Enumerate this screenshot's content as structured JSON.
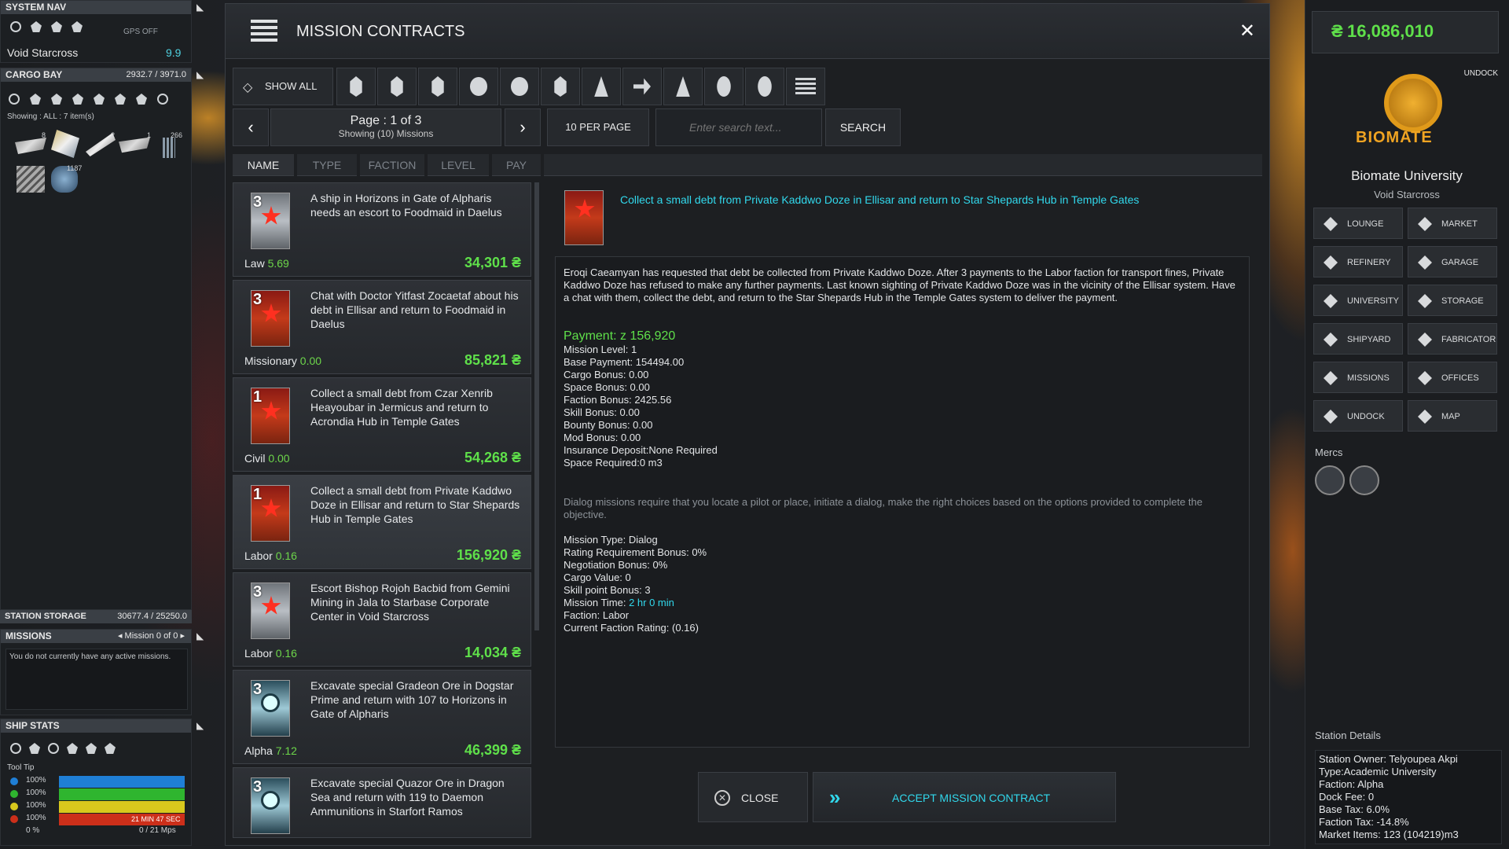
{
  "left": {
    "system_nav": {
      "header": "SYSTEM NAV",
      "gps": "GPS OFF",
      "system": "Void Starcross",
      "value": "9.9"
    },
    "cargo": {
      "header": "CARGO BAY",
      "capacity": "2932.7 / 3971.0",
      "showing": "Showing : ALL : 7 item(s)",
      "q1": "8",
      "q2": "2",
      "q3": "1",
      "q4": "266",
      "q5": "1187"
    },
    "station_storage": {
      "header": "STATION STORAGE",
      "capacity": "30677.4 / 25250.0"
    },
    "missions": {
      "header": "MISSIONS",
      "pager": "Mission 0 of 0",
      "empty": "You do not currently have any active missions."
    },
    "ship_stats": {
      "header": "SHIP STATS",
      "tooltip": "Tool Tip",
      "rows": [
        {
          "pct": "100%",
          "color": "#1f7fd6"
        },
        {
          "pct": "100%",
          "color": "#2fb52f"
        },
        {
          "pct": "100%",
          "color": "#d8c81d"
        },
        {
          "pct": "100%",
          "color": "#cc2f1a",
          "extra": "21 MIN 47 SEC"
        }
      ],
      "last_pct": "0 %",
      "last_extra": "0 / 21 Mps"
    }
  },
  "contracts": {
    "title": "MISSION CONTRACTS",
    "show_all": "SHOW ALL",
    "page": "Page : 1 of 3",
    "showing": "Showing (10) Missions",
    "per_page": "10  PER PAGE",
    "search_placeholder": "Enter search text...",
    "search_label": "SEARCH",
    "columns": [
      "NAME",
      "TYPE",
      "FACTION",
      "LEVEL",
      "PAY"
    ],
    "list": [
      {
        "level": "3",
        "desc": "A ship in Horizons in Gate of Alpharis needs an escort to Foodmaid in Daelus",
        "faction": "Law",
        "rating": "5.69",
        "pay": "34,301 ₴",
        "badge": "gray"
      },
      {
        "level": "3",
        "desc": "Chat with Doctor Yitfast Zocaetaf about his debt in Ellisar and return to Foodmaid in Daelus",
        "faction": "Missionary",
        "rating": "0.00",
        "pay": "85,821 ₴",
        "badge": "red"
      },
      {
        "level": "1",
        "desc": "Collect a small debt from Czar Xenrib Heayoubar in Jermicus and return to Acrondia Hub in Temple Gates",
        "faction": "Civil",
        "rating": "0.00",
        "pay": "54,268 ₴",
        "badge": "red"
      },
      {
        "level": "1",
        "desc": "Collect a small debt from Private Kaddwo Doze in Ellisar and return to Star Shepards Hub in Temple Gates",
        "faction": "Labor",
        "rating": "0.16",
        "pay": "156,920 ₴",
        "badge": "red"
      },
      {
        "level": "3",
        "desc": "Escort Bishop Rojoh Bacbid from Gemini Mining in Jala to Starbase Corporate Center in Void Starcross",
        "faction": "Labor",
        "rating": "0.16",
        "pay": "14,034 ₴",
        "badge": "gray"
      },
      {
        "level": "3",
        "desc": "Excavate special Gradeon Ore in Dogstar Prime and return with 107 to Horizons in Gate of Alpharis",
        "faction": "Alpha",
        "rating": "7.12",
        "pay": "46,399 ₴",
        "badge": "teal"
      },
      {
        "level": "3",
        "desc": "Excavate special Quazor Ore in Dragon Sea and return with 119 to Daemon Ammunitions in Starfort Ramos",
        "faction": "",
        "rating": "",
        "pay": "",
        "badge": "teal"
      }
    ],
    "detail": {
      "title": "Collect a small debt from Private Kaddwo Doze in Ellisar and return to Star Shepards Hub in Temple Gates",
      "para1": "Eroqi Caeamyan has requested that debt be collected from Private Kaddwo Doze. After 3 payments to the Labor faction for transport fines, Private Kaddwo Doze has refused to make any further payments. Last known sighting of Private Kaddwo Doze was in the vicinity of the Ellisar system. Have a chat with them, collect the debt, and return to the Star Shepards Hub in the Temple Gates system to deliver the payment.",
      "payment": "Payment: z 156,920",
      "lines": [
        "Mission Level: 1",
        "Base Payment: 154494.00",
        "Cargo Bonus: 0.00",
        "Space Bonus: 0.00",
        "Faction Bonus: 2425.56",
        "Skill Bonus: 0.00",
        "Bounty Bonus: 0.00",
        "Mod Bonus: 0.00",
        "Insurance Deposit:None Required",
        "Space Required:0 m3"
      ],
      "note": "Dialog missions require that you locate a pilot or place, initiate a dialog, make the right choices based on the options provided to complete the objective.",
      "lines2": [
        "Mission Type: Dialog",
        "Rating Requirement Bonus: 0%",
        "Negotiation Bonus: 0%",
        "Cargo Value: 0",
        "Skill point Bonus: 3"
      ],
      "time_label": "Mission Time: ",
      "time_value": "2 hr 0 min",
      "lines3": [
        "Faction: Labor",
        "Current Faction Rating: (0.16)"
      ]
    },
    "close": "CLOSE",
    "accept": "ACCEPT MISSION CONTRACT"
  },
  "right": {
    "credits": "16,086,010",
    "undock_top": "UNDOCK",
    "logo": "BIOMATE",
    "station": "Biomate University",
    "system": "Void Starcross",
    "nav": [
      "LOUNGE",
      "MARKET",
      "REFINERY",
      "GARAGE",
      "UNIVERSITY",
      "STORAGE",
      "SHIPYARD",
      "FABRICATOR",
      "MISSIONS",
      "OFFICES",
      "UNDOCK",
      "MAP"
    ],
    "mercs": "Mercs",
    "details_header": "Station Details",
    "details": [
      "Station Owner: Telyoupea Akpi",
      "Type:Academic University",
      "Faction: Alpha",
      "Dock Fee: 0",
      "Base Tax: 6.0%",
      "Faction Tax: -14.8%",
      "Market Items: 123 (104219)m3"
    ]
  }
}
